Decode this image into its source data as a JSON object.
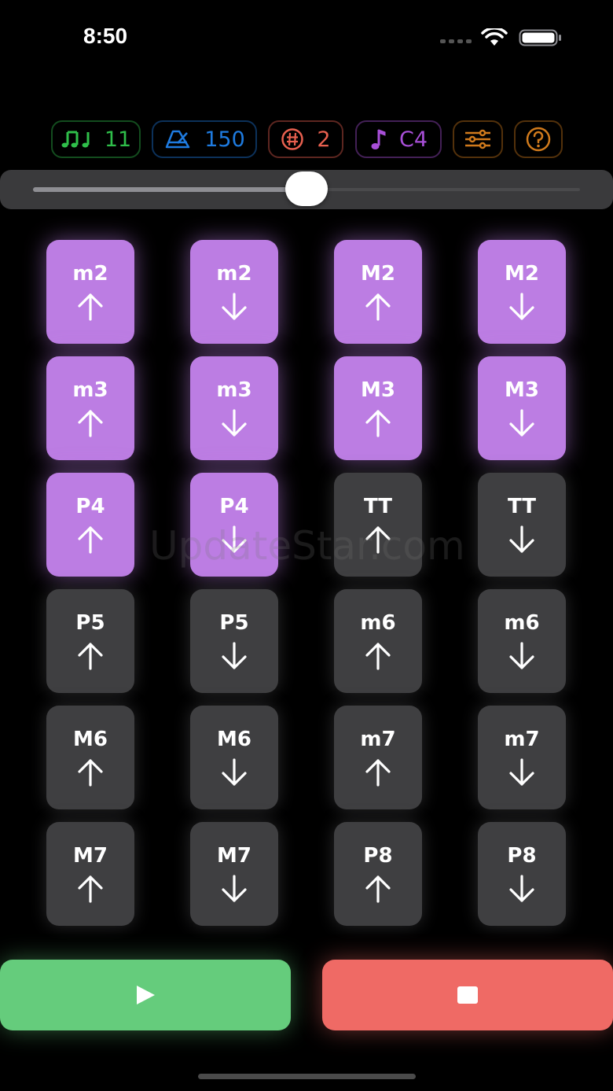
{
  "status_bar": {
    "time": "8:50"
  },
  "toolbar": {
    "notes_count": "11",
    "tempo": "150",
    "accidentals": "2",
    "root_note": "C4"
  },
  "slider": {
    "value_fraction": 0.5
  },
  "colors": {
    "notes_chip": "#2fbf4a",
    "tempo_chip": "#1e7be0",
    "accidentals_chip": "#e8604f",
    "root_chip": "#a84fd8",
    "settings_chip": "#d07a1c",
    "help_chip": "#d07a1c",
    "active_tile": "#bc7de3",
    "inactive_tile": "#3f3f41",
    "play": "#65cc7c",
    "stop": "#ef6a65"
  },
  "intervals": [
    [
      {
        "label": "m2",
        "dir": "up",
        "active": true
      },
      {
        "label": "m2",
        "dir": "down",
        "active": true
      },
      {
        "label": "M2",
        "dir": "up",
        "active": true
      },
      {
        "label": "M2",
        "dir": "down",
        "active": true
      }
    ],
    [
      {
        "label": "m3",
        "dir": "up",
        "active": true
      },
      {
        "label": "m3",
        "dir": "down",
        "active": true
      },
      {
        "label": "M3",
        "dir": "up",
        "active": true
      },
      {
        "label": "M3",
        "dir": "down",
        "active": true
      }
    ],
    [
      {
        "label": "P4",
        "dir": "up",
        "active": true
      },
      {
        "label": "P4",
        "dir": "down",
        "active": true
      },
      {
        "label": "TT",
        "dir": "up",
        "active": false
      },
      {
        "label": "TT",
        "dir": "down",
        "active": false
      }
    ],
    [
      {
        "label": "P5",
        "dir": "up",
        "active": false
      },
      {
        "label": "P5",
        "dir": "down",
        "active": false
      },
      {
        "label": "m6",
        "dir": "up",
        "active": false
      },
      {
        "label": "m6",
        "dir": "down",
        "active": false
      }
    ],
    [
      {
        "label": "M6",
        "dir": "up",
        "active": false
      },
      {
        "label": "M6",
        "dir": "down",
        "active": false
      },
      {
        "label": "m7",
        "dir": "up",
        "active": false
      },
      {
        "label": "m7",
        "dir": "down",
        "active": false
      }
    ],
    [
      {
        "label": "M7",
        "dir": "up",
        "active": false
      },
      {
        "label": "M7",
        "dir": "down",
        "active": false
      },
      {
        "label": "P8",
        "dir": "up",
        "active": false
      },
      {
        "label": "P8",
        "dir": "down",
        "active": false
      }
    ]
  ],
  "watermark": "UpdateStar.com",
  "icons": {
    "notes": "music-notes-icon",
    "tempo": "metronome-icon",
    "accidentals": "sharp-icon",
    "root": "music-note-icon",
    "settings": "sliders-icon",
    "help": "question-icon",
    "play": "play-icon",
    "stop": "stop-icon"
  }
}
